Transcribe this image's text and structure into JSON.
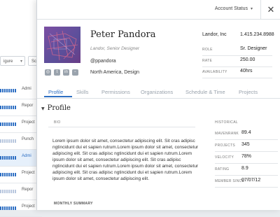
{
  "background_app": {
    "filter_left": "igure",
    "filter_right": "Sc",
    "rows": [
      {
        "label": "Admi",
        "selected": false,
        "bars": "dark"
      },
      {
        "label": "Repor",
        "selected": false,
        "bars": "dark"
      },
      {
        "label": "Project",
        "selected": false,
        "bars": "dark"
      },
      {
        "label": "Punch",
        "selected": false,
        "bars": "light"
      },
      {
        "label": "Admi",
        "selected": true,
        "bars": "dark"
      },
      {
        "label": "Project",
        "selected": false,
        "bars": "dark"
      },
      {
        "label": "Repor",
        "selected": false,
        "bars": "light"
      },
      {
        "label": "Project",
        "selected": false,
        "bars": "dark"
      }
    ]
  },
  "header": {
    "account_status": "Account Status",
    "close": "✕"
  },
  "profile": {
    "name": "Peter Pandora",
    "subtitle": "Landor, Senior Designer",
    "handle": "@ppandora",
    "location": "North America, Design",
    "company": "Landor, Inc",
    "phone": "1.415.234.8988",
    "fields": [
      {
        "key": "ROLE",
        "value": "Sr. Designer"
      },
      {
        "key": "RATE",
        "value": "250.00"
      },
      {
        "key": "AVAILABILITY",
        "value": "40hrs"
      }
    ]
  },
  "tabs": [
    "Profile",
    "Skills",
    "Permissions",
    "Organizations",
    "Schedule & Time",
    "Projects"
  ],
  "section": {
    "title": "Profile",
    "bio_label": "BIO",
    "bio_text": "Lorem ipsum dolor sit amet, consectetur adipiscing elit. Sit cras adipisc ngtincidunt dui et sapien rutrum.Lorem ipsum dolor sit amet, consectetur adipiscing elit. Sit cras adipisc ngtincidunt dui et sapien rutrum.Lorem ipsum dolor sit amet, consectetur adipiscing elit. Sit cras adipisc ngtincidunt dui et sapien rutrum.Lorem ipsum dolor sit amet, consectetur adipiscing elit. Sit cras adipisc ngtincidunt dui et sapien rutrum.Lorem ipsum dolor sit amet, consectetur adipiscing elit.",
    "historical_label": "HISTORICAL",
    "historical": [
      {
        "key": "MAVENRANK",
        "value": "89.4"
      },
      {
        "key": "PROJECTS",
        "value": "345"
      },
      {
        "key": "VELOCITY",
        "value": "78%"
      },
      {
        "key": "RATING",
        "value": "8.9"
      },
      {
        "key": "MEMBER SINCE",
        "value": "07/07/12"
      }
    ],
    "monthly_label": "MONTHLY SUMMARY"
  },
  "icons": {
    "social": [
      "dribbble-icon",
      "twitter-icon",
      "linkedin-icon",
      "chat-icon"
    ]
  },
  "colors": {
    "accent": "#2e6fc3",
    "avatar": "#6a4a9e"
  }
}
